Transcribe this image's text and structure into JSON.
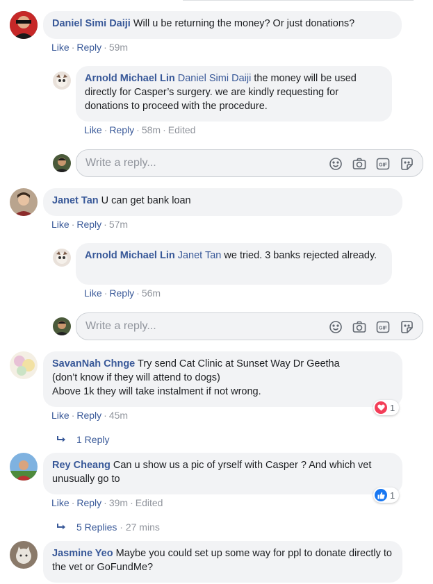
{
  "comments": [
    {
      "author": "Daniel Simi Daiji",
      "text": "Will u be returning the money? Or just donations?",
      "like": "Like",
      "reply": "Reply",
      "time": "59m",
      "replies": [
        {
          "author": "Arnold Michael Lin",
          "mention": "Daniel Simi Daiji",
          "text": "the money will be used directly for Casper’s surgery. we are kindly requesting for donations to proceed with the procedure.",
          "like": "Like",
          "reply": "Reply",
          "time": "58m",
          "edited": "Edited"
        }
      ],
      "reply_placeholder": "Write a reply..."
    },
    {
      "author": "Janet Tan",
      "text": "U can get bank loan",
      "like": "Like",
      "reply": "Reply",
      "time": "57m",
      "replies": [
        {
          "author": "Arnold Michael Lin",
          "mention": "Janet Tan",
          "text": "we tried. 3 banks rejected already.",
          "like": "Like",
          "reply": "Reply",
          "time": "56m"
        }
      ],
      "reply_placeholder": "Write a reply..."
    },
    {
      "author": "SavanNah Chnge",
      "text_lines": [
        "Try send Cat Clinic at Sunset Way Dr Geetha",
        "(don’t know if they will attend to dogs)",
        "Above 1k they will take instalment if not wrong."
      ],
      "like": "Like",
      "reply": "Reply",
      "time": "45m",
      "reaction": {
        "icon": "heart-icon",
        "count": "1",
        "color": "#f33e58"
      },
      "replies_link": "1 Reply"
    },
    {
      "author": "Rey Cheang",
      "text": "Can u show us a pic of yrself with Casper ? And which vet unusually go to",
      "like": "Like",
      "reply": "Reply",
      "time": "39m",
      "edited": "Edited",
      "reaction": {
        "icon": "thumbs-up-icon",
        "count": "1",
        "color": "#1877f2"
      },
      "replies_link": "5 Replies",
      "replies_time": "27 mins"
    },
    {
      "author": "Jasmine Yeo",
      "text": "Maybe you could set up some way for ppl to donate directly to the vet or GoFundMe?"
    }
  ],
  "colors": {
    "link": "#385898",
    "bubble": "#f2f3f5",
    "meta": "#90949c"
  },
  "reply_tools": [
    "smiley-icon",
    "camera-icon",
    "gif-icon",
    "sticker-icon"
  ]
}
